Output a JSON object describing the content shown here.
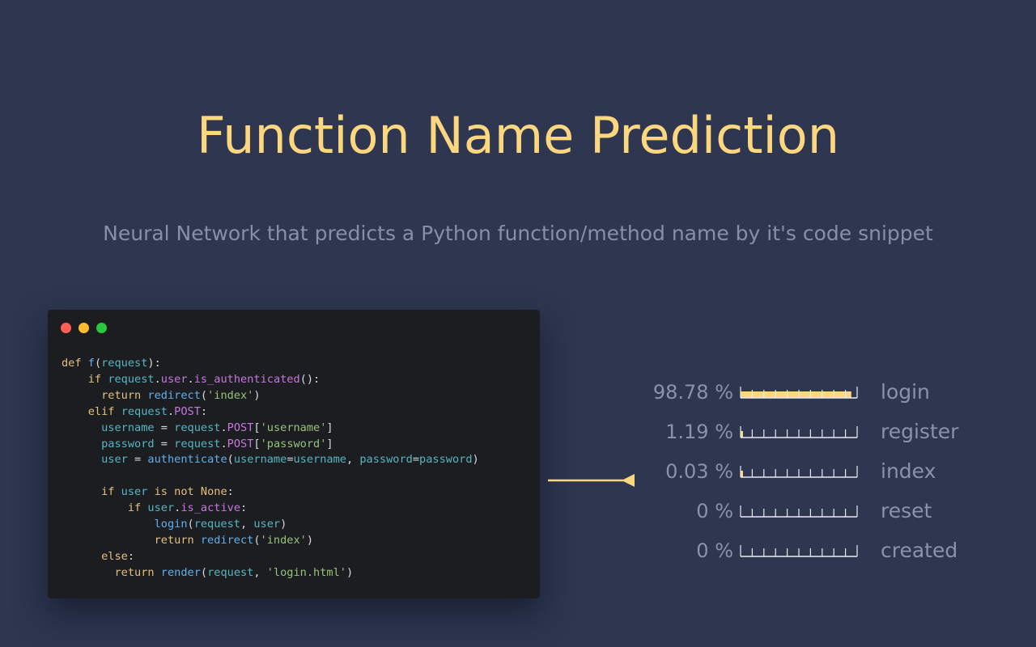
{
  "title": "Function Name Prediction",
  "subtitle": "Neural Network that predicts a Python function/method name by it's code snippet",
  "colors": {
    "background": "#2e3650",
    "accent": "#fcd77f",
    "muted_text": "#8b93a7",
    "code_background": "#1b1d21"
  },
  "code_window": {
    "icons": [
      "close-dot-icon",
      "minimize-dot-icon",
      "maximize-dot-icon"
    ],
    "code": "def f(request):\n    if request.user.is_authenticated():\n      return redirect('index')\n    elif request.POST:\n      username = request.POST['username']\n      password = request.POST['password']\n      user = authenticate(username=username, password=password)\n\n      if user is not None:\n          if user.is_active:\n              login(request, user)\n              return redirect('index')\n      else:\n        return render(request, 'login.html')"
  },
  "predictions": [
    {
      "percent": "98.78 %",
      "value": 98.78,
      "label": "login"
    },
    {
      "percent": "1.19 %",
      "value": 1.19,
      "label": "register"
    },
    {
      "percent": "0.03 %",
      "value": 0.03,
      "label": "index"
    },
    {
      "percent": "0 %",
      "value": 0,
      "label": "reset"
    },
    {
      "percent": "0 %",
      "value": 0,
      "label": "created"
    }
  ]
}
